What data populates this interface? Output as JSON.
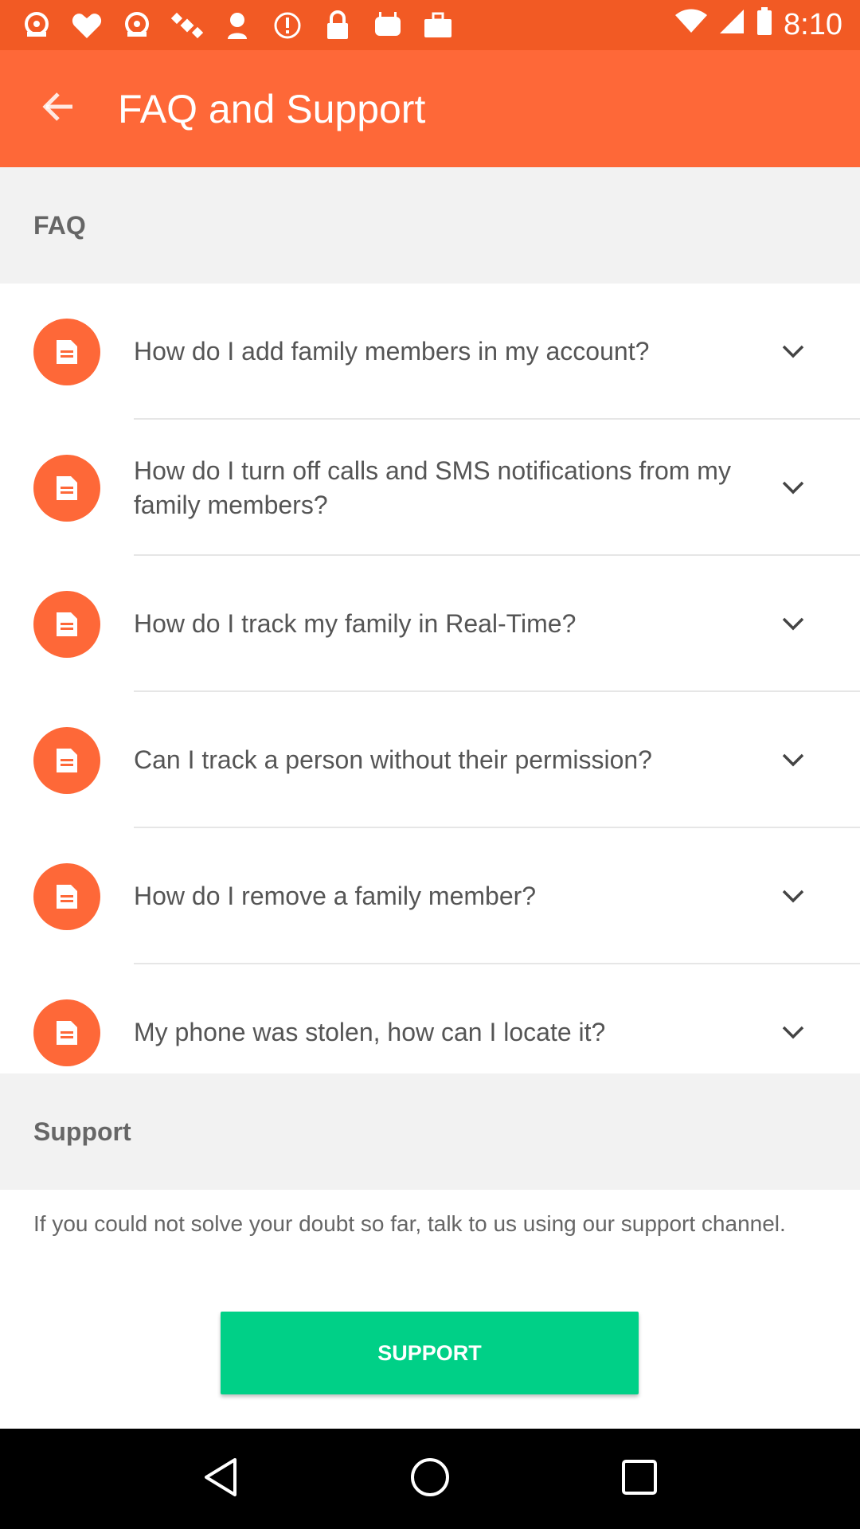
{
  "status_bar": {
    "time": "8:10",
    "icons": [
      "fake-gps-icon",
      "heart-icon",
      "fake-gps-icon",
      "satellite-icon",
      "location-alert-icon",
      "alert-circle-icon",
      "lock-icon",
      "android-icon",
      "briefcase-icon"
    ]
  },
  "app_bar": {
    "title": "FAQ and Support"
  },
  "faq": {
    "header": "FAQ",
    "items": [
      {
        "question": "How do I add family members in my account?"
      },
      {
        "question": "How do I turn off calls and SMS notifications from my family members?"
      },
      {
        "question": "How do I track my family in Real-Time?"
      },
      {
        "question": "Can I track a person without their permission?"
      },
      {
        "question": "How do I remove a family member?"
      },
      {
        "question": "My phone was stolen, how can I locate it?"
      }
    ]
  },
  "support": {
    "header": "Support",
    "text": "If you could not solve your doubt so far, talk to us using our support channel.",
    "button_label": "SUPPORT"
  },
  "colors": {
    "status_bar": "#F25A24",
    "app_bar": "#FE6838",
    "accent_orange": "#FE6838",
    "support_button": "#00D087"
  }
}
